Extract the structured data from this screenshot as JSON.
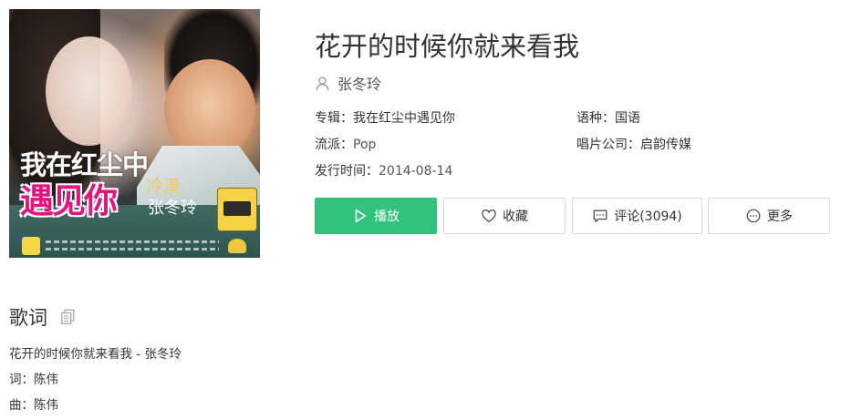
{
  "cover": {
    "title_line1": "我在红尘中",
    "title_line2": "遇见你",
    "tag": "冷漠",
    "artist": "张冬玲"
  },
  "song": {
    "title": "花开的时候你就来看我",
    "artist": "张冬玲"
  },
  "meta": {
    "album_label": "专辑：",
    "album_value": "我在红尘中遇见你",
    "language_label": "语种：",
    "language_value": "国语",
    "genre_label": "流派：",
    "genre_value": "Pop",
    "company_label": "唱片公司：",
    "company_value": "启韵传媒",
    "release_label": "发行时间：",
    "release_value": "2014-08-14"
  },
  "actions": {
    "play_label": "播放",
    "fav_label": "收藏",
    "comment_label": "评论(3094)",
    "more_label": "更多"
  },
  "lyrics": {
    "heading": "歌词",
    "lines": [
      "花开的时候你就来看我 - 张冬玲",
      "词：陈伟",
      "曲：陈伟"
    ]
  },
  "colors": {
    "accent": "#31c27c",
    "cover_pink": "#e0157e"
  },
  "icons": {
    "artist": "user-icon",
    "play": "play-icon",
    "fav": "heart-icon",
    "comment": "comment-icon",
    "more": "more-icon",
    "copy": "copy-icon"
  }
}
